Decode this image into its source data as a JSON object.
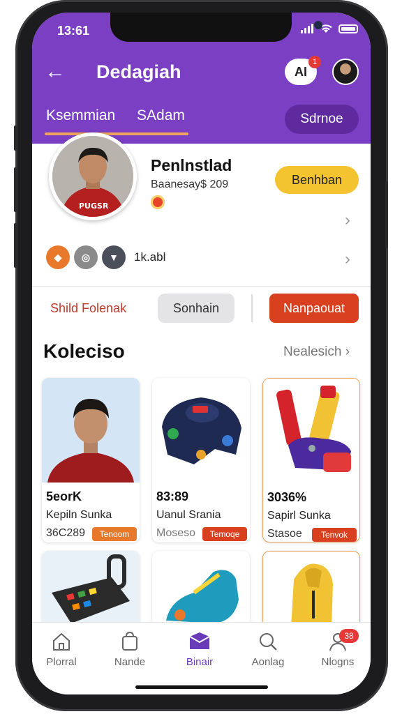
{
  "status": {
    "time": "13:61"
  },
  "header": {
    "title": "Dedagiah",
    "chip_label": "AI",
    "chip_badge": "1",
    "tabs": [
      {
        "label": "Ksemmian"
      },
      {
        "label": "SAdam"
      }
    ],
    "pill_label": "Sdrnoe"
  },
  "profile": {
    "name": "Penlnstlad",
    "subtitle": "Baanesay$ 209",
    "follow_label": "Benhban",
    "badge_count": "1k.abl"
  },
  "actions": {
    "text_link": "Shild Folenak",
    "grey_button": "Sonhain",
    "red_button": "Nanpaouat"
  },
  "collection": {
    "title": "Koleciso",
    "see_all": "Nealesich",
    "items": [
      {
        "price": "5eorK",
        "name": "Kepiln Sunka",
        "meta": "36C289",
        "tag": "Tenoom"
      },
      {
        "price": "83:89",
        "name": "Uanul Srania",
        "meta": "Moseso",
        "tag": "Temoqe"
      },
      {
        "price": "3036%",
        "name": "Sapirl Sunka",
        "meta": "Stasoe",
        "tag": "Tenvok"
      }
    ]
  },
  "bottom_nav": {
    "items": [
      {
        "label": "Plorral"
      },
      {
        "label": "Nande"
      },
      {
        "label": "Binair"
      },
      {
        "label": "Aonlag"
      },
      {
        "label": "Nlogns"
      }
    ],
    "badge": "38",
    "active_color": "#6a3bb8"
  },
  "colors": {
    "brand": "#7b3fc4",
    "accent": "#f4c430",
    "danger": "#d9401f"
  }
}
